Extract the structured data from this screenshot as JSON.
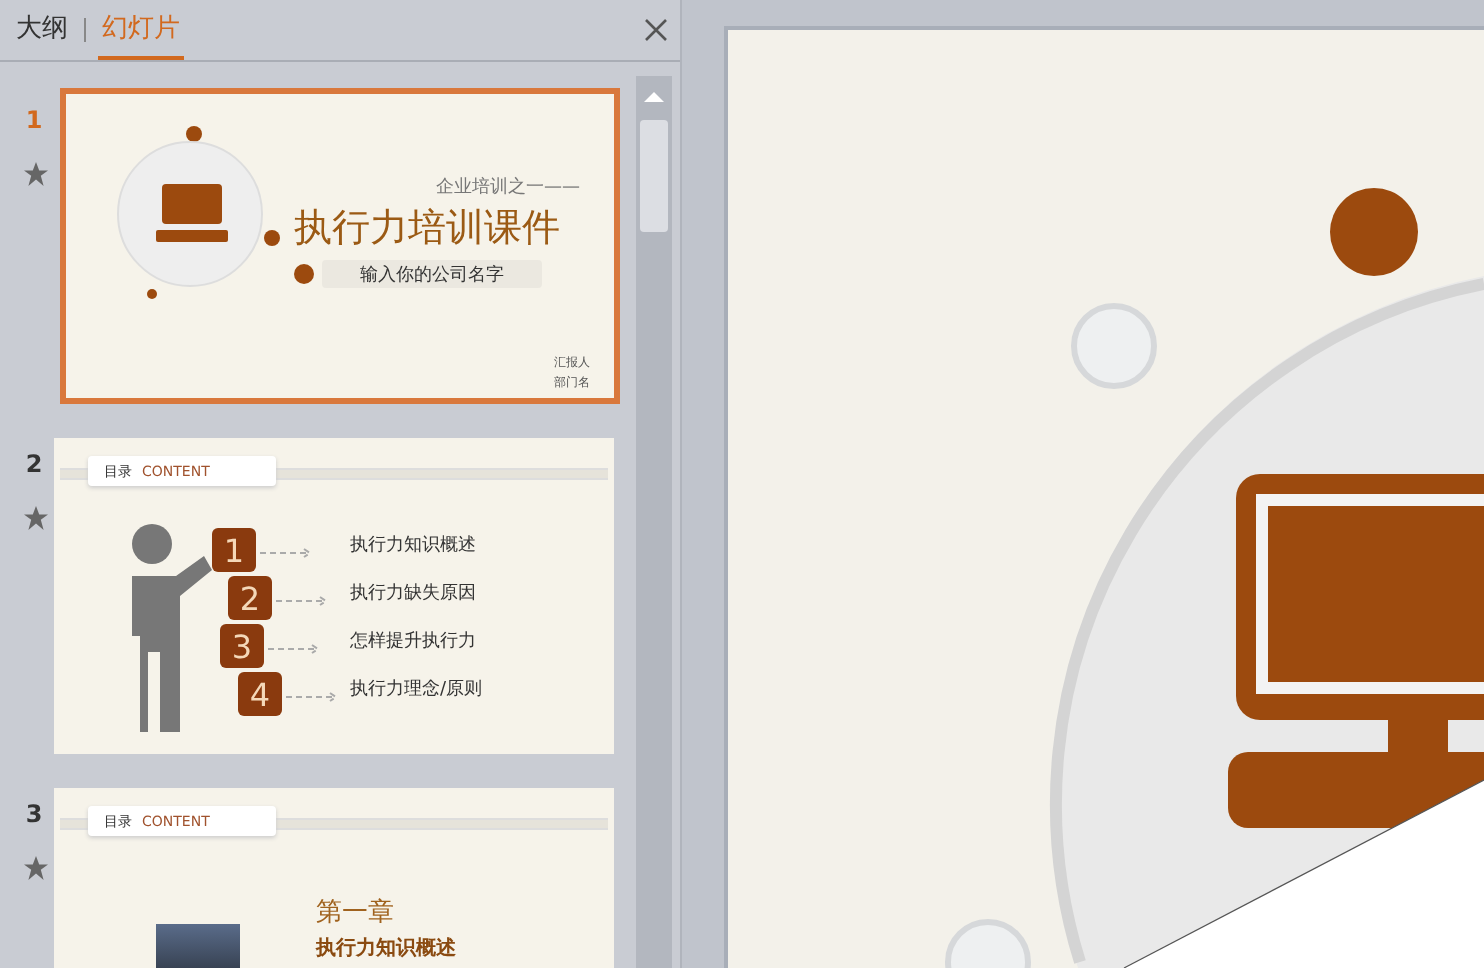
{
  "panel": {
    "tabs": [
      {
        "label": "大纲",
        "selected": false
      },
      {
        "label": "幻灯片",
        "selected": true
      }
    ]
  },
  "slides": [
    {
      "kind": "title",
      "number": "1",
      "selected": true,
      "subtitle": "企业培训之一——",
      "title": "执行力培训课件",
      "company_field": "输入你的公司名字",
      "footer": [
        "汇报人",
        "部门名"
      ]
    },
    {
      "kind": "contents",
      "number": "2",
      "selected": false,
      "header": "目录",
      "header_en": "CONTENT",
      "items": [
        {
          "num": "1",
          "text": "执行力知识概述"
        },
        {
          "num": "2",
          "text": "执行力缺失原因"
        },
        {
          "num": "3",
          "text": "怎样提升执行力"
        },
        {
          "num": "4",
          "text": "执行力理念/原则"
        }
      ]
    },
    {
      "kind": "chapter",
      "number": "3",
      "selected": false,
      "header": "目录",
      "header_en": "CONTENT",
      "chapter": "第一章",
      "heading": "执行力知识概述"
    }
  ]
}
